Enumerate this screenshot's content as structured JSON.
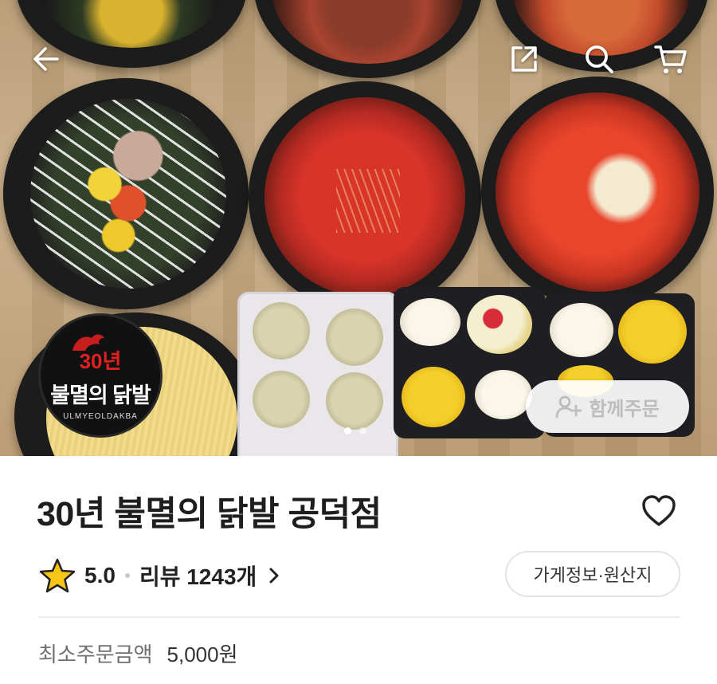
{
  "hero": {
    "logo": {
      "years": "30년",
      "name": "불멸의 닭발",
      "sub": "ULMYEOLDAKBA"
    },
    "icons": {
      "back": "arrow-left-icon",
      "share": "share-icon",
      "search": "search-icon",
      "cart": "cart-icon"
    },
    "carousel": {
      "total": 2,
      "active": 1
    },
    "together_order": {
      "icon": "person-add-icon",
      "label": "함께주문"
    }
  },
  "store": {
    "name": "30년 불멸의 닭발 공덕점",
    "favorite_icon": "heart-outline-icon",
    "rating": "5.0",
    "review_label": "리뷰 1243개",
    "info_button": "가게정보·원산지",
    "min_order_label": "최소주문금액",
    "min_order_value": "5,000원"
  },
  "colors": {
    "star": "#f5c518",
    "accent_red": "#e02020",
    "text_dark": "#1e1e1e",
    "text_muted": "#6f6f6f"
  }
}
